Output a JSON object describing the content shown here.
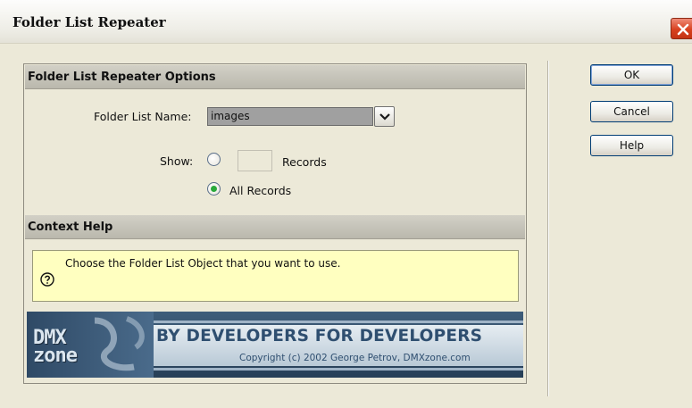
{
  "window": {
    "title": "Folder List Repeater",
    "close_icon": "close-icon"
  },
  "options": {
    "header": "Folder List Repeater Options",
    "folder_list_label": "Folder List Name:",
    "folder_list_value": "images",
    "show_label": "Show:",
    "records_label": "Records",
    "records_value": "",
    "all_records_label": "All Records",
    "selected_show_option": "All Records"
  },
  "context_help": {
    "header": "Context Help",
    "text": "Choose the Folder List Object that you want to use.",
    "icon": "help-question-icon"
  },
  "banner": {
    "logo_line1": "DMX",
    "logo_line2": "zone",
    "slogan": "BY DEVELOPERS FOR DEVELOPERS",
    "copyright": "Copyright (c) 2002 George Petrov, DMXzone.com"
  },
  "buttons": {
    "ok": "OK",
    "cancel": "Cancel",
    "help": "Help"
  },
  "colors": {
    "dialog_bg": "#ece9d8",
    "help_bg": "#ffffc0",
    "close_red": "#d8411f",
    "radio_selected": "#29a93a",
    "banner_text": "#2f4f70"
  }
}
